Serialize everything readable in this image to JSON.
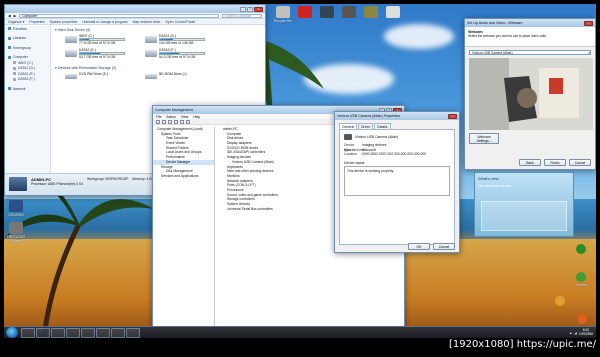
{
  "desktop": {
    "icons_top": [
      {
        "label": "Recycle Bin",
        "color": "#c0c0c0"
      },
      {
        "label": "",
        "color": "#c22"
      },
      {
        "label": "",
        "color": "#345"
      },
      {
        "label": "",
        "color": "#555"
      },
      {
        "label": "",
        "color": "#884"
      },
      {
        "label": "",
        "color": "#ddd"
      }
    ],
    "icons_left": [
      {
        "label": "GENSHIN",
        "color": "#2a4f8a"
      },
      {
        "label": "FREEUSES Shortcut",
        "color": "#777"
      }
    ],
    "icons_right": [
      {
        "label": "",
        "color": "#2a8a2a"
      },
      {
        "label": "uTorrent",
        "color": "#3c9e35"
      },
      {
        "label": "",
        "color": "#e0a030"
      },
      {
        "label": "",
        "color": "#e06020"
      }
    ]
  },
  "explorer": {
    "address": "Computer",
    "search_placeholder": "Search Computer",
    "toolbar": [
      "Organize ▾",
      "Properties",
      "System properties",
      "Uninstall or change a program",
      "Map network drive",
      "Open Control Panel"
    ],
    "nav": [
      {
        "label": "Favorites",
        "sub": false,
        "gap": false
      },
      {
        "label": "Libraries",
        "sub": false,
        "gap": true
      },
      {
        "label": "Homegroup",
        "sub": false,
        "gap": true
      },
      {
        "label": "Computer",
        "sub": false,
        "gap": true
      },
      {
        "label": "WIN7 (C:)",
        "sub": true,
        "gap": false
      },
      {
        "label": "DATA1 (D:)",
        "sub": true,
        "gap": false
      },
      {
        "label": "DATA2 (E:)",
        "sub": true,
        "gap": false
      },
      {
        "label": "DATA3 (F:)",
        "sub": true,
        "gap": false
      },
      {
        "label": "Network",
        "sub": false,
        "gap": true
      }
    ],
    "hdd_header": "Hard Disk Drives (4)",
    "drives": [
      {
        "name": "WIN7 (C:)",
        "free": "77.6 GB free of 97.6 GB",
        "used": 0.2
      },
      {
        "name": "DATA1 (D:)",
        "free": "104 GB free of 146 GB",
        "used": 0.29
      },
      {
        "name": "DATA2 (E:)",
        "free": "53.7 GB free of 97.6 GB",
        "used": 0.45
      },
      {
        "name": "DATA3 (F:)",
        "free": "54.3 GB free of 97.6 GB",
        "used": 0.44
      }
    ],
    "removable_header": "Devices with Removable Storage (2)",
    "removable": [
      {
        "name": "DVD RW Drive (E:)"
      },
      {
        "name": "BD-ROM Drive (I:)"
      }
    ],
    "details": {
      "pc_name": "ADMIN-PC",
      "workgroup": "Workgroup: WORKGROUP",
      "memory": "Memory: 4.00 GB",
      "processor": "Processor: AMD Phenom(tm) II X4"
    }
  },
  "compmgmt": {
    "title": "Computer Management",
    "menu": [
      "File",
      "Action",
      "View",
      "Help"
    ],
    "left_tree": [
      {
        "label": "Computer Management (Local)",
        "lvl": 1,
        "sel": false
      },
      {
        "label": "System Tools",
        "lvl": 2,
        "sel": false
      },
      {
        "label": "Task Scheduler",
        "lvl": 3,
        "sel": false
      },
      {
        "label": "Event Viewer",
        "lvl": 3,
        "sel": false
      },
      {
        "label": "Shared Folders",
        "lvl": 3,
        "sel": false
      },
      {
        "label": "Local Users and Groups",
        "lvl": 3,
        "sel": false
      },
      {
        "label": "Performance",
        "lvl": 3,
        "sel": false
      },
      {
        "label": "Device Manager",
        "lvl": 3,
        "sel": true
      },
      {
        "label": "Storage",
        "lvl": 2,
        "sel": false
      },
      {
        "label": "Disk Management",
        "lvl": 3,
        "sel": false
      },
      {
        "label": "Services and Applications",
        "lvl": 2,
        "sel": false
      }
    ],
    "device_tree": [
      {
        "label": "admin-PC",
        "lvl": 1
      },
      {
        "label": "Computer",
        "lvl": 2
      },
      {
        "label": "Disk drives",
        "lvl": 2
      },
      {
        "label": "Display adapters",
        "lvl": 2
      },
      {
        "label": "DVD/CD-ROM drives",
        "lvl": 2
      },
      {
        "label": "IDE ATA/ATAPI controllers",
        "lvl": 2
      },
      {
        "label": "Imaging devices",
        "lvl": 2
      },
      {
        "label": "Vimicro USB Camera (Altair)",
        "lvl": 3
      },
      {
        "label": "Keyboards",
        "lvl": 2
      },
      {
        "label": "Mice and other pointing devices",
        "lvl": 2
      },
      {
        "label": "Monitors",
        "lvl": 2
      },
      {
        "label": "Network adapters",
        "lvl": 2
      },
      {
        "label": "Ports (COM & LPT)",
        "lvl": 2
      },
      {
        "label": "Processors",
        "lvl": 2
      },
      {
        "label": "Sound, video and game controllers",
        "lvl": 2
      },
      {
        "label": "Storage controllers",
        "lvl": 2
      },
      {
        "label": "System devices",
        "lvl": 2
      },
      {
        "label": "Universal Serial Bus controllers",
        "lvl": 2
      }
    ]
  },
  "props": {
    "title": "Vimicro USB Camera (Altair) Properties",
    "tabs": [
      "General",
      "Driver",
      "Details"
    ],
    "device_name": "Vimicro USB Camera (Altair)",
    "rows": [
      {
        "k": "Device type:",
        "v": "Imaging devices"
      },
      {
        "k": "Manufacturer:",
        "v": "Microsoft"
      },
      {
        "k": "Location:",
        "v": "0000.0002.0007.002.000.000.000.000.000"
      }
    ],
    "status_group": "Device status",
    "status_text": "This device is working properly.",
    "ok": "OK",
    "cancel": "Cancel"
  },
  "webcam": {
    "title": "Set Up Audio and Video - Webcam",
    "heading": "Webcam",
    "instruction": "Select the webcam you want to use to place video calls:",
    "selected": "Vimicro USB Camera (Altair)",
    "settings_button": "Webcam Settings...",
    "back": "Back",
    "finish": "Finish",
    "cancel": "Cancel",
    "live_title": "Windows Live Messenger"
  },
  "messenger": {
    "whats_new": "What's new",
    "contact": "eyin.mosafe88 led.com"
  },
  "taskbar": {
    "time": "8:00",
    "date": "10/5/2556"
  },
  "credit": "[1920x1080] https://upic.me/"
}
